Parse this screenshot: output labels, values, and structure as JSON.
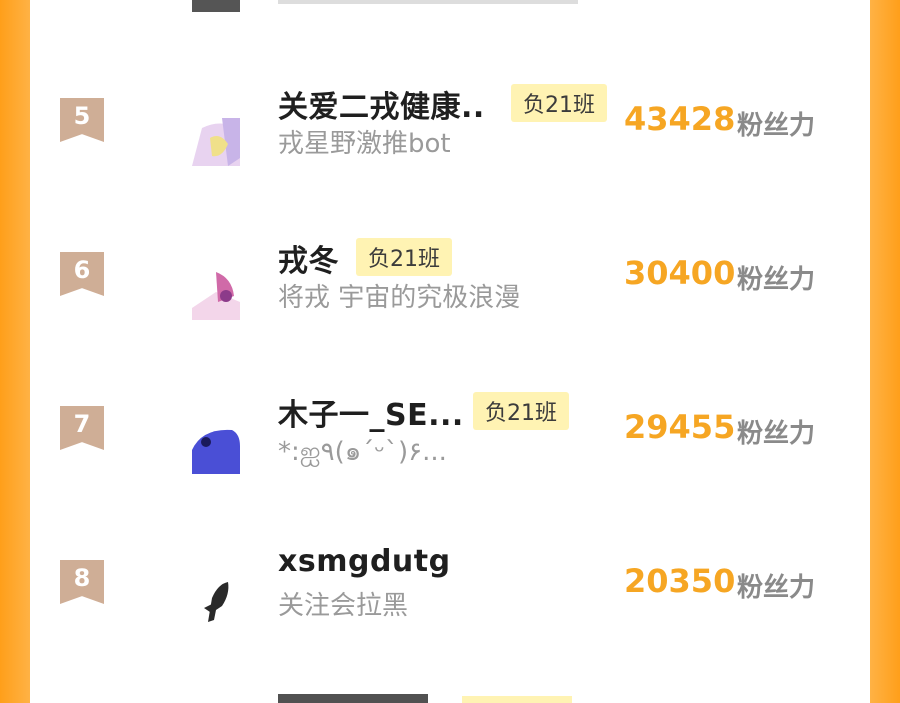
{
  "unit_label": "粉丝力",
  "entries": [
    {
      "rank": "5",
      "name": "关爱二戎健康..",
      "badge": "负21班",
      "subtitle": "戎星野激推bot",
      "score": "43428"
    },
    {
      "rank": "6",
      "name": "戎冬",
      "badge": "负21班",
      "subtitle": "将戎 宇宙的究极浪漫",
      "score": "30400"
    },
    {
      "rank": "7",
      "name": "木子一_SE...",
      "badge": "负21班",
      "subtitle": "*:ஐ٩(๑´ᵕ`)۶...",
      "score": "29455"
    },
    {
      "rank": "8",
      "name": "xsmgdutg",
      "badge": "",
      "subtitle": "关注会拉黑",
      "score": "20350"
    }
  ],
  "colors": {
    "accent": "#f6a623",
    "rank_badge": "#cfae96",
    "class_badge": "#fff3b3",
    "border": "#ff9f1a"
  }
}
